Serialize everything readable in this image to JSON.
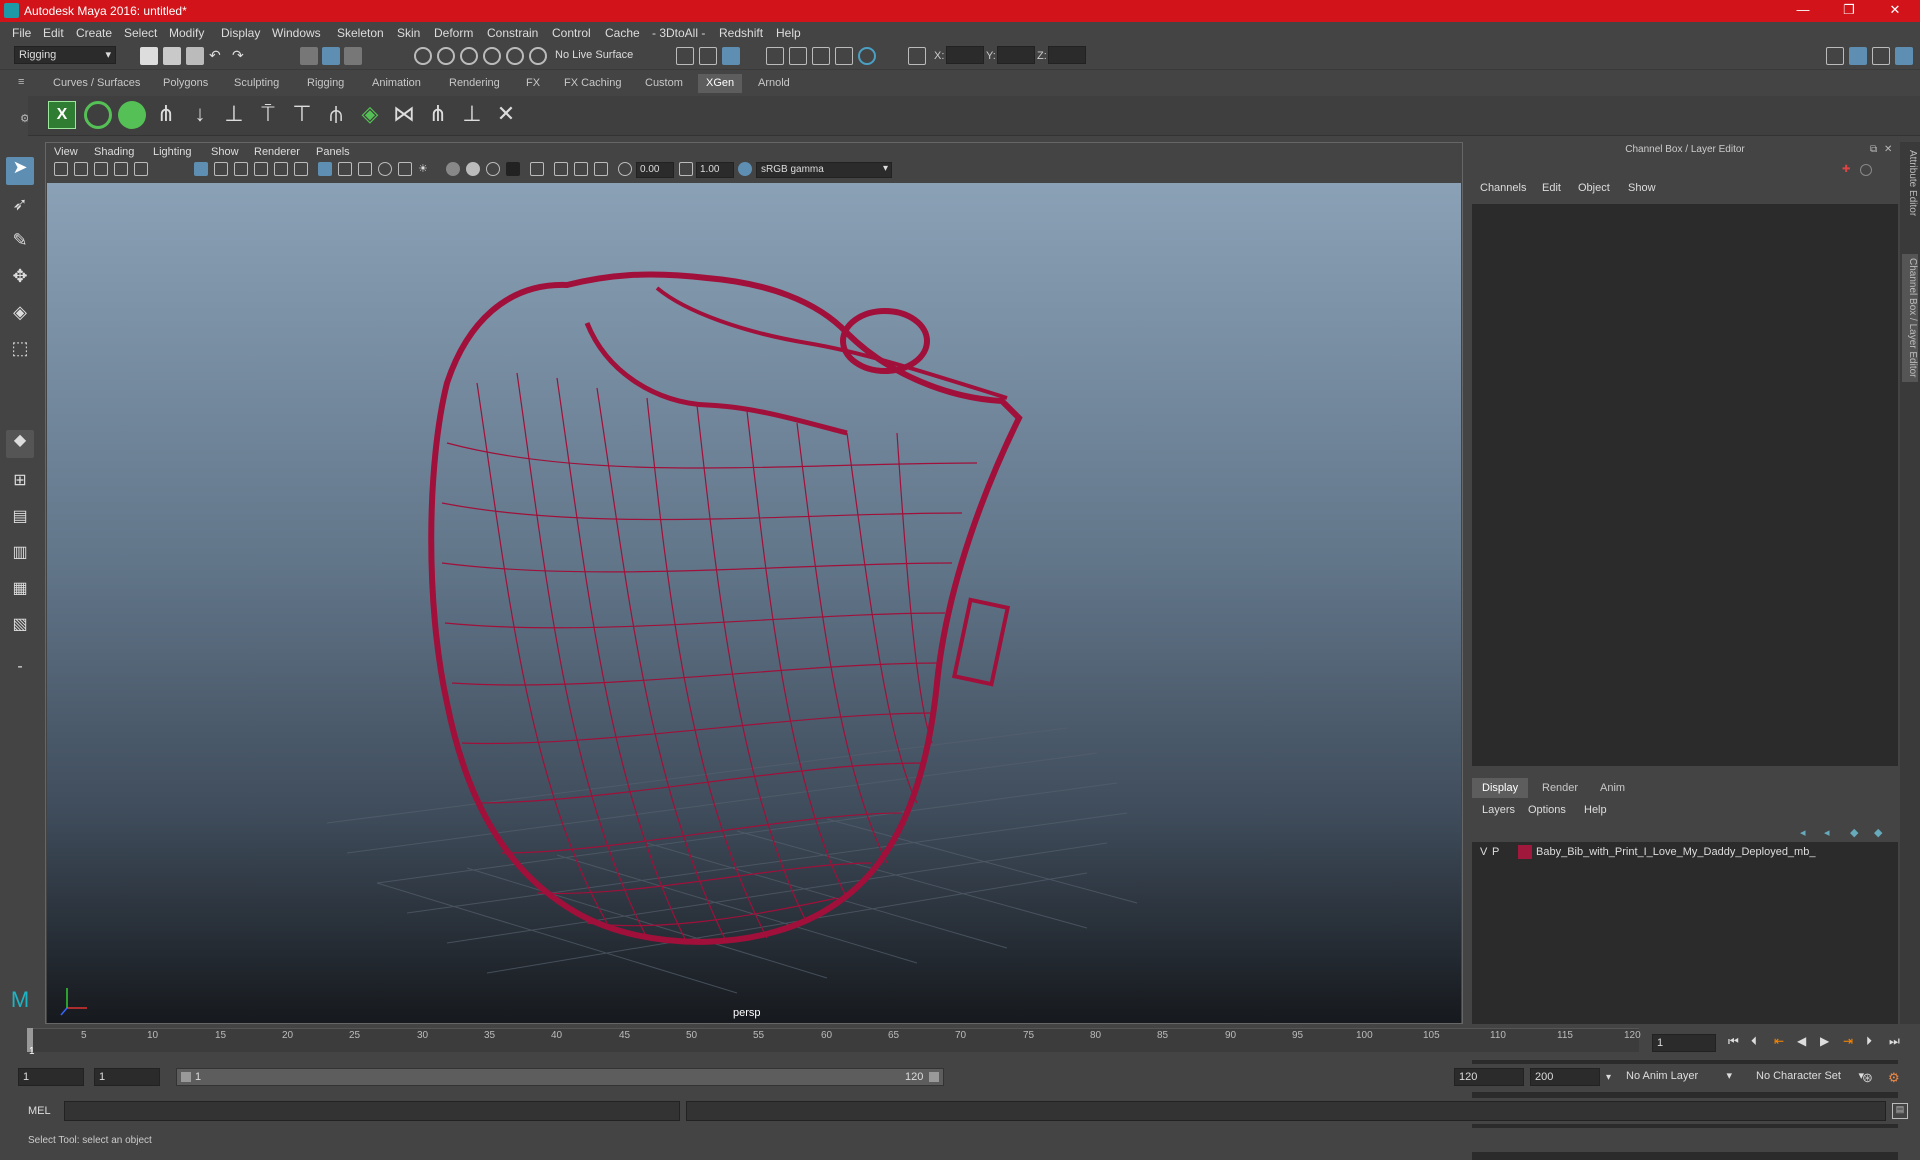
{
  "window": {
    "title": "Autodesk Maya 2016: untitled*"
  },
  "menubar": [
    "File",
    "Edit",
    "Create",
    "Select",
    "Modify",
    "Display",
    "Windows",
    "Skeleton",
    "Skin",
    "Deform",
    "Constrain",
    "Control",
    "Cache",
    "- 3DtoAll -",
    "Redshift",
    "Help"
  ],
  "statusline": {
    "mode": "Rigging",
    "live_surface": "No Live Surface",
    "x_label": "X:",
    "y_label": "Y:",
    "z_label": "Z:"
  },
  "shelf_tabs": [
    "Curves / Surfaces",
    "Polygons",
    "Sculpting",
    "Rigging",
    "Animation",
    "Rendering",
    "FX",
    "FX Caching",
    "Custom",
    "XGen",
    "Arnold"
  ],
  "shelf_active": "XGen",
  "viewport": {
    "menus": [
      "View",
      "Shading",
      "Lighting",
      "Show",
      "Renderer",
      "Panels"
    ],
    "exposure": "0.00",
    "gamma": "1.00",
    "color_space": "sRGB gamma",
    "camera": "persp"
  },
  "channel_box": {
    "title": "Channel Box / Layer Editor",
    "menus": [
      "Channels",
      "Edit",
      "Object",
      "Show"
    ]
  },
  "layer_editor": {
    "tabs": [
      "Display",
      "Render",
      "Anim"
    ],
    "active_tab": "Display",
    "menus": [
      "Layers",
      "Options",
      "Help"
    ],
    "layers": [
      {
        "v": "V",
        "p": "P",
        "color": "#a0183c",
        "name": "Baby_Bib_with_Print_I_Love_My_Daddy_Deployed_mb_sta"
      }
    ]
  },
  "side_tabs": [
    "Attribute Editor",
    "Channel Box / Layer Editor"
  ],
  "time_slider": {
    "ticks": [
      "1",
      "5",
      "10",
      "15",
      "20",
      "25",
      "30",
      "35",
      "40",
      "45",
      "50",
      "55",
      "60",
      "65",
      "70",
      "75",
      "80",
      "85",
      "90",
      "95",
      "100",
      "105",
      "110",
      "115",
      "120"
    ],
    "current_frame": "1"
  },
  "range_slider": {
    "start": "1",
    "anim_start": "1",
    "range_start": "1",
    "range_end": "120",
    "anim_end": "120",
    "end": "200",
    "anim_layer": "No Anim Layer",
    "character_set": "No Character Set"
  },
  "command_line": {
    "label": "MEL"
  },
  "help_line": {
    "text": "Select Tool: select an object"
  },
  "colors": {
    "wire": "#a0103a",
    "accent": "#5d5d5d",
    "title_bar": "#d2141a"
  }
}
